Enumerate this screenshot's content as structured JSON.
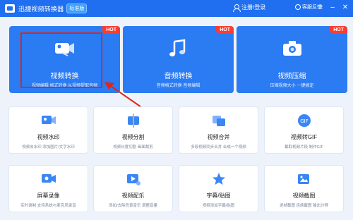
{
  "window": {
    "title": "迅捷视频转换器",
    "badge": "标准版",
    "login": "注册/登录",
    "feedback": "客服反馈",
    "menu": "≡",
    "minimize": "–",
    "close": "✕"
  },
  "big_features": [
    {
      "title": "视频转换",
      "desc": "视频编辑 格式转换 从视频提取音频",
      "hot": "HOT"
    },
    {
      "title": "音频转换",
      "desc": "音频格式转换 音频编辑",
      "hot": "HOT"
    },
    {
      "title": "视频压缩",
      "desc": "压缩视频大小 一键搞定",
      "hot": "HOT"
    }
  ],
  "tools": [
    {
      "title": "视频水印",
      "desc": "视频去水印 添加图片/文字水印"
    },
    {
      "title": "视频分割",
      "desc": "视频长度切割 画面裁剪"
    },
    {
      "title": "视频合并",
      "desc": "多段视频同步合并 合成一个视频"
    },
    {
      "title": "视频转GIF",
      "desc": "截取视频片段 制作GIF"
    },
    {
      "title": "屏幕录像",
      "desc": "实时录制 支持系统与麦克风录音"
    },
    {
      "title": "视频配乐",
      "desc": "添加/去除背景音乐 调整音量"
    },
    {
      "title": "字幕/贴图",
      "desc": "视频添加字幕/贴图"
    },
    {
      "title": "视频截图",
      "desc": "逐帧截图 连续截图 输出分辨"
    }
  ],
  "colors": {
    "titlebar": "#1f6ff0",
    "big_card": "#2b7bf3",
    "hot": "#ff3b30",
    "highlight": "#e0251b"
  }
}
